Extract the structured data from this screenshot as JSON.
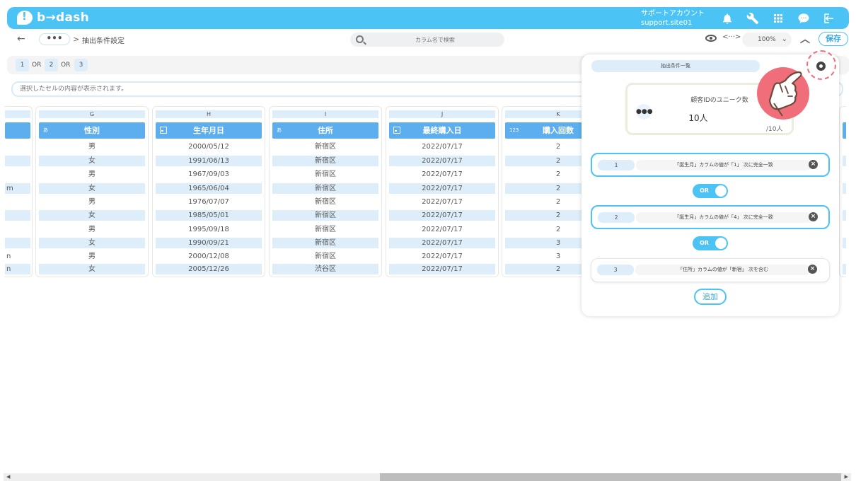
{
  "header": {
    "logo_text": "b→dash",
    "account_name": "サポートアカウント",
    "account_id": "support.site01",
    "icons": [
      "bell-icon",
      "wrench-icon",
      "grid-icon",
      "chat-icon",
      "logout-icon"
    ],
    "color": "#4cc3f5"
  },
  "toolbar": {
    "back": "←",
    "more": "•••",
    "crumb_sep": ">",
    "breadcrumb": "抽出条件設定",
    "search_placeholder": "カラム名で検索",
    "code": "<···>",
    "zoom": "100%",
    "save": "保存"
  },
  "conditions_bar": {
    "chips": [
      "1",
      "2",
      "3"
    ],
    "or_label": "OR"
  },
  "cell_display": "選択したセルの内容が表示されます。",
  "grid": {
    "columns": [
      {
        "letter": "G",
        "type": "あ",
        "name": "性別",
        "values": [
          "男",
          "女",
          "男",
          "女",
          "男",
          "女",
          "男",
          "女",
          "男",
          "女"
        ]
      },
      {
        "letter": "H",
        "type": "date",
        "name": "生年月日",
        "values": [
          "2000/05/12",
          "1991/06/13",
          "1967/09/03",
          "1965/06/04",
          "1976/07/07",
          "1985/05/01",
          "1995/09/18",
          "1990/09/21",
          "2000/12/08",
          "2005/12/26"
        ]
      },
      {
        "letter": "I",
        "type": "あ",
        "name": "住所",
        "values": [
          "新宿区",
          "新宿区",
          "新宿区",
          "新宿区",
          "新宿区",
          "新宿区",
          "新宿区",
          "新宿区",
          "新宿区",
          "渋谷区"
        ]
      },
      {
        "letter": "J",
        "type": "date",
        "name": "最終購入日",
        "values": [
          "2022/07/17",
          "2022/07/17",
          "2022/07/17",
          "2022/07/17",
          "2022/07/17",
          "2022/07/17",
          "2022/07/17",
          "2022/07/17",
          "2022/07/17",
          "2022/07/17"
        ]
      },
      {
        "letter": "K",
        "type": "123",
        "name": "購入回数",
        "values": [
          "2",
          "2",
          "2",
          "2",
          "2",
          "2",
          "2",
          "3",
          "3",
          "2"
        ]
      }
    ],
    "partial_left_values": [
      "",
      "",
      "",
      "m",
      "",
      "",
      "",
      "",
      "n",
      "n"
    ]
  },
  "panel": {
    "title": "抽出条件一覧",
    "kpi_label": "顧客IDのユニーク数",
    "kpi_value": "10人",
    "kpi_total": "/10人",
    "conditions": [
      {
        "num": "1",
        "text": "「誕生月」カラムの値が「1」 次に完全一致",
        "active": true
      },
      {
        "num": "2",
        "text": "「誕生月」カラムの値が「4」 次に完全一致",
        "active": true
      },
      {
        "num": "3",
        "text": "「住所」カラムの値が「新宿」 次を含む",
        "active": false
      }
    ],
    "or_toggle": "OR",
    "add": "追加"
  }
}
